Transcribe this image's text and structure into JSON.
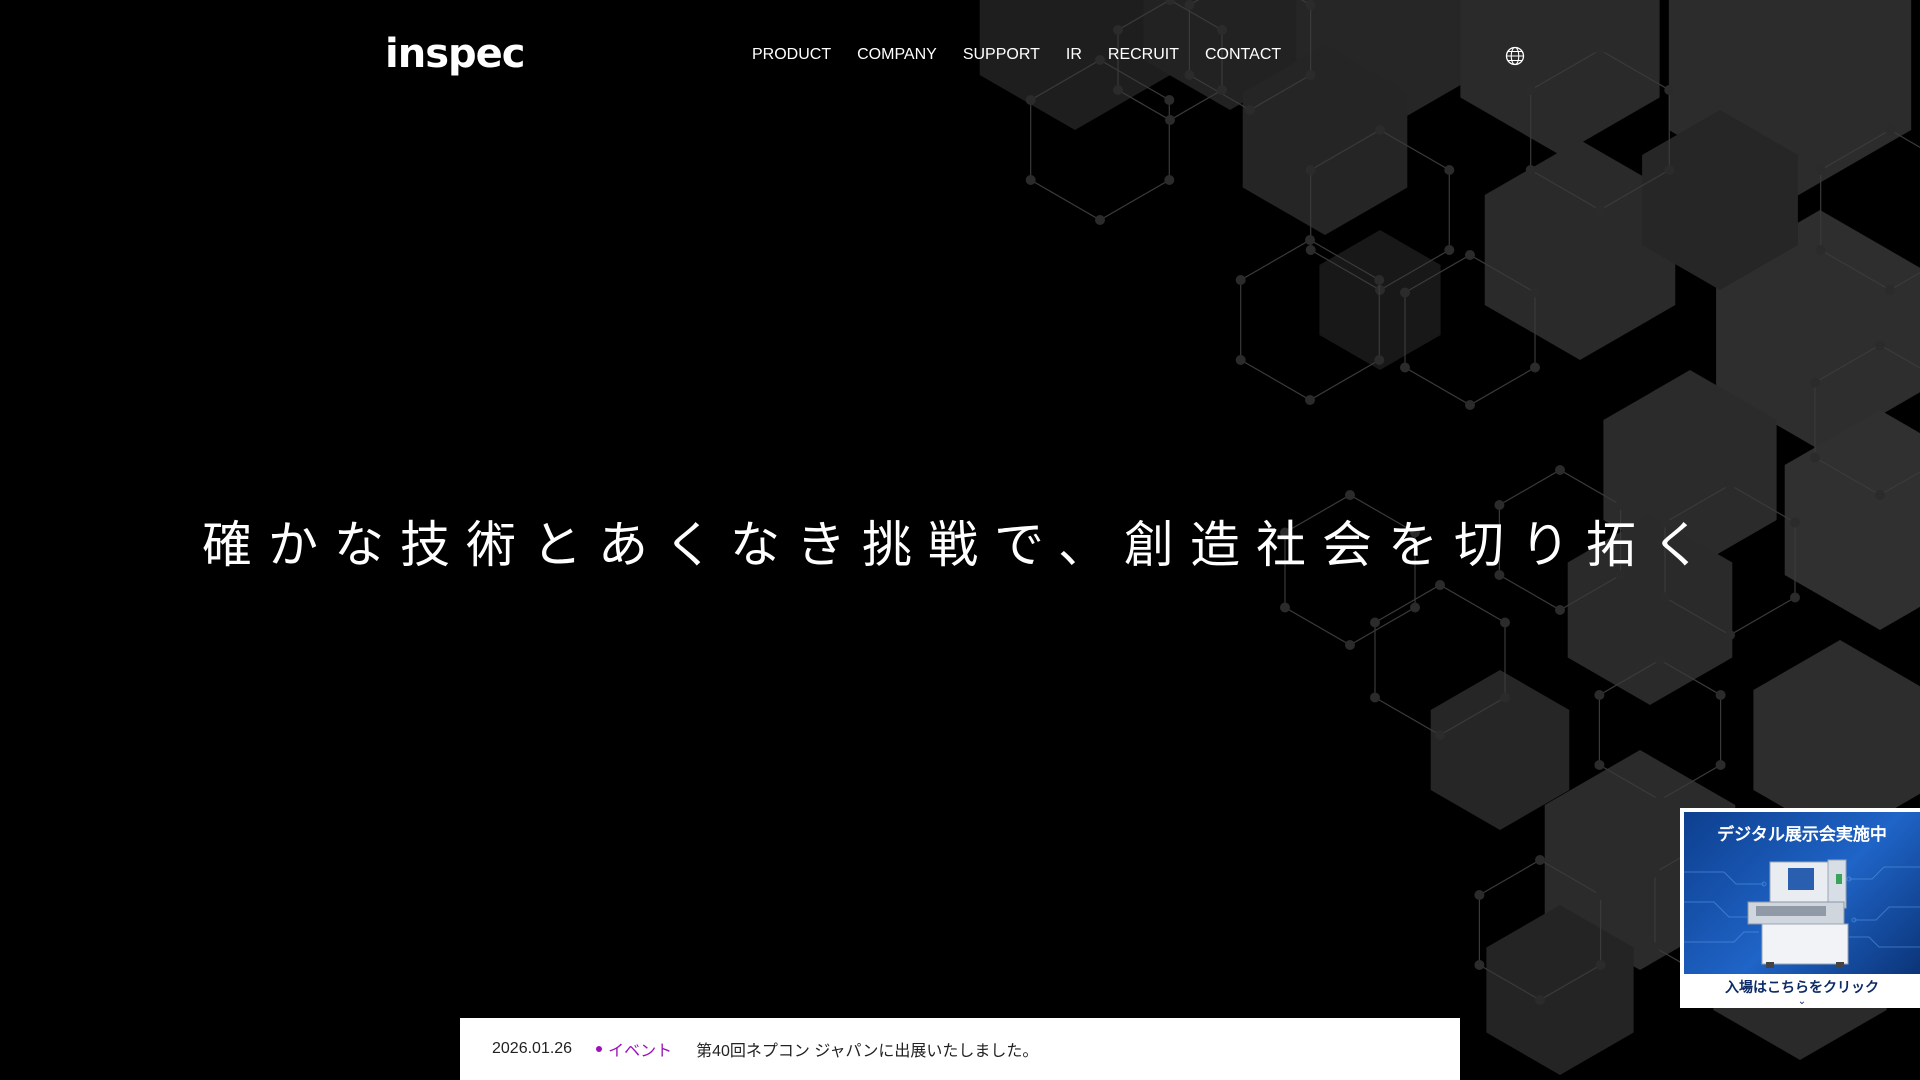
{
  "header": {
    "logo_text": "inspec",
    "nav": [
      {
        "label": "PRODUCT"
      },
      {
        "label": "COMPANY"
      },
      {
        "label": "SUPPORT"
      },
      {
        "label": "IR"
      },
      {
        "label": "RECRUIT"
      },
      {
        "label": "CONTACT"
      }
    ],
    "language_icon": "globe-icon"
  },
  "hero": {
    "title": "確かな技術とあくなき挑戦で、創造社会を切り拓く"
  },
  "news": {
    "date": "2026.01.26",
    "category": "イベント",
    "text": "第40回ネプコン ジャパンに出展いたしました。",
    "category_color": "#9b12b8"
  },
  "banner": {
    "title": "デジタル展示会実施中",
    "cta": "入場はこちらをクリック",
    "chevron_icon": "chevron-down-icon",
    "background_color": "#1f64c7"
  }
}
